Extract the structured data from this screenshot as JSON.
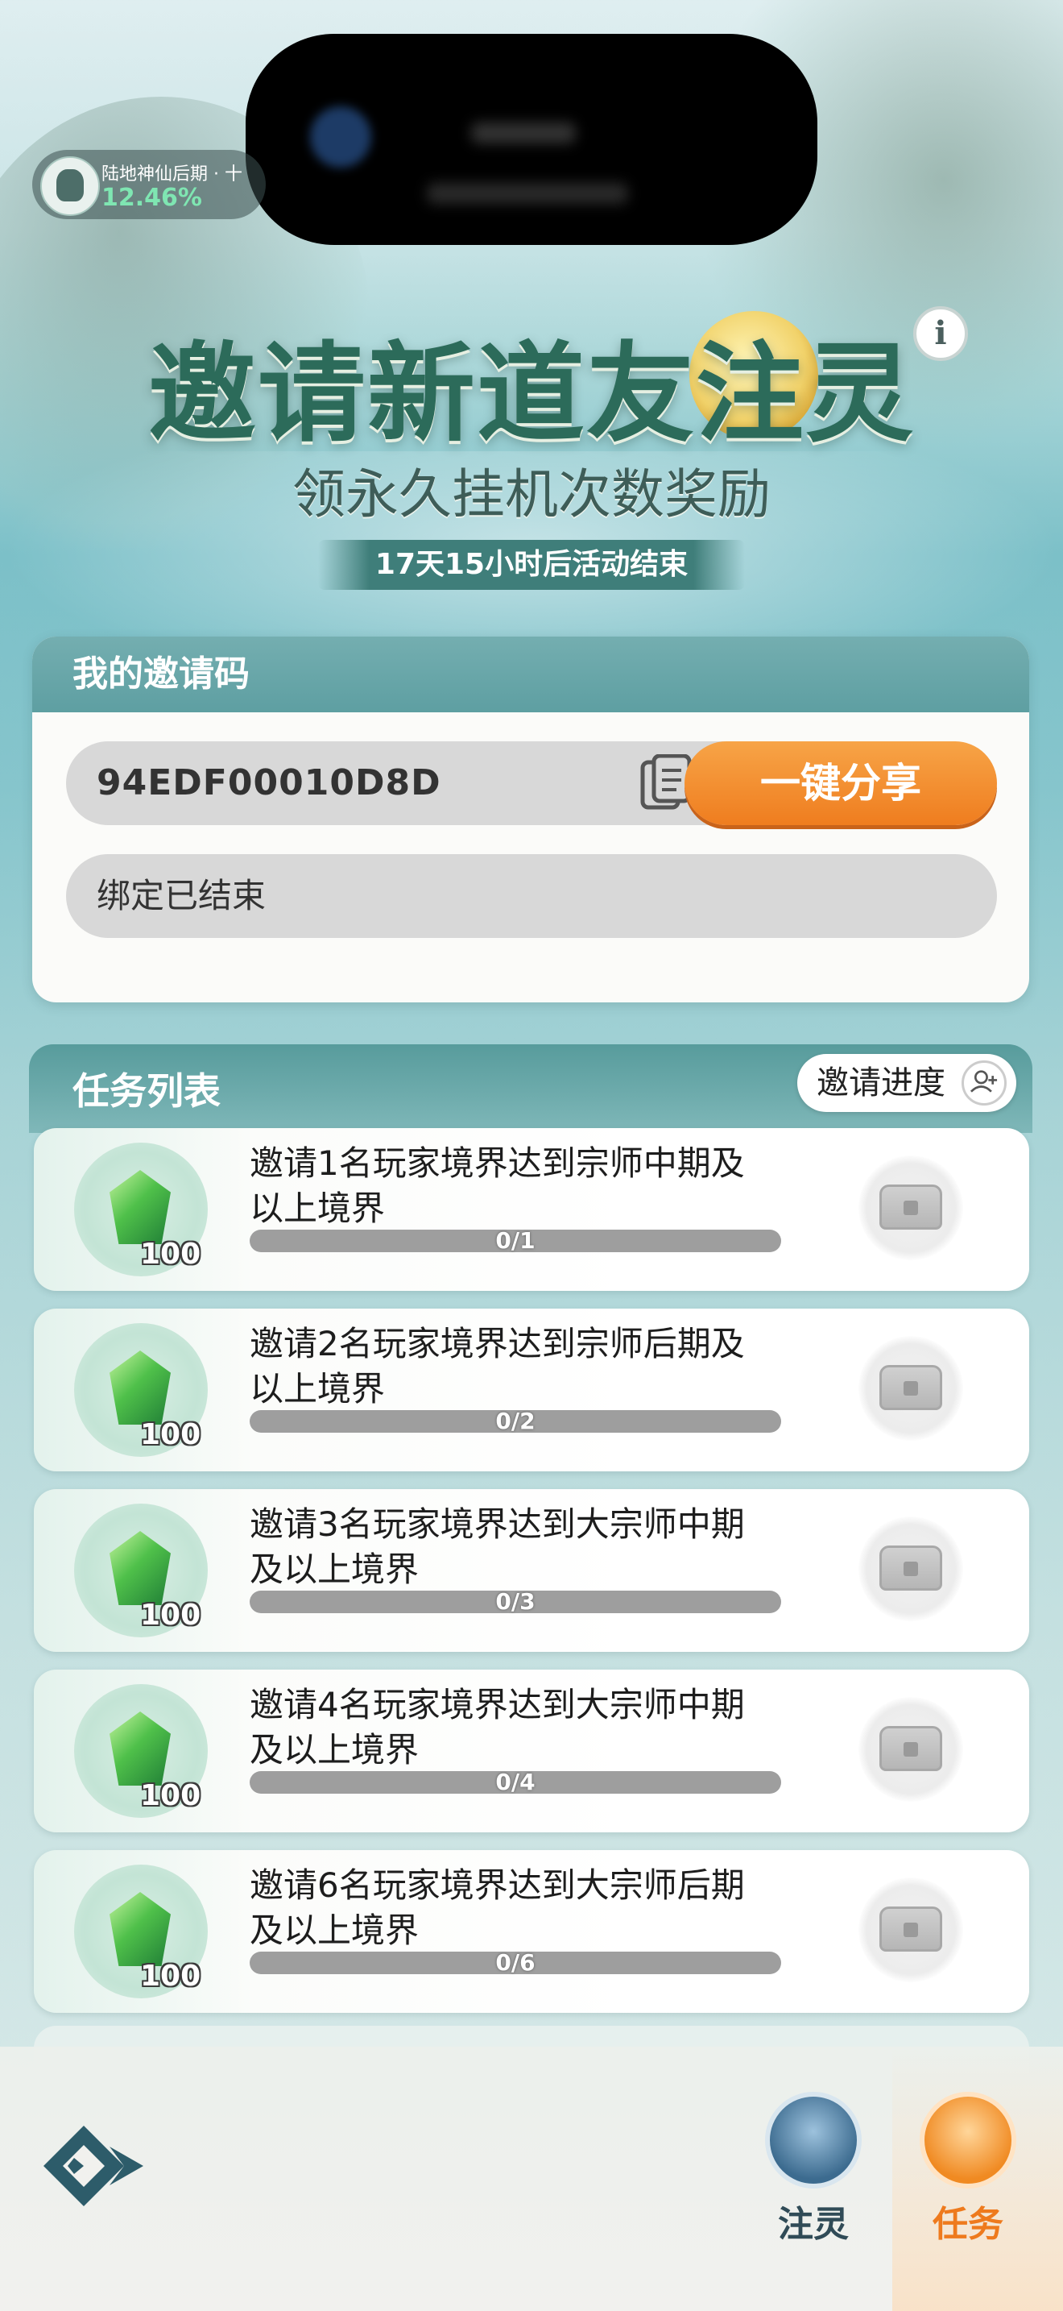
{
  "status": {
    "realm_name": "陆地神仙后期 · 十",
    "realm_percent": "12.46%"
  },
  "header": {
    "title": "邀请新道友注灵",
    "info_label": "i",
    "subtitle": "领永久挂机次数奖励",
    "countdown": "17天15小时后活动结束"
  },
  "invite": {
    "heading": "我的邀请码",
    "code": "94EDF00010D8D",
    "share_label": "一键分享",
    "bind_status": "绑定已结束"
  },
  "tasks": {
    "heading": "任务列表",
    "progress_label": "邀请进度",
    "items": [
      {
        "desc": "邀请1名玩家境界达到宗师中期及以上境界",
        "reward": "100",
        "progress": "0/1",
        "ratio": 0
      },
      {
        "desc": "邀请2名玩家境界达到宗师后期及以上境界",
        "reward": "100",
        "progress": "0/2",
        "ratio": 0
      },
      {
        "desc": "邀请3名玩家境界达到大宗师中期及以上境界",
        "reward": "100",
        "progress": "0/3",
        "ratio": 0
      },
      {
        "desc": "邀请4名玩家境界达到大宗师中期及以上境界",
        "reward": "100",
        "progress": "0/4",
        "ratio": 0
      },
      {
        "desc": "邀请6名玩家境界达到大宗师后期及以上境界",
        "reward": "100",
        "progress": "0/6",
        "ratio": 0
      }
    ]
  },
  "nav": {
    "spirit_label": "注灵",
    "task_label": "任务"
  },
  "icons": {
    "info": "info-icon",
    "copy": "copy-icon",
    "add_user": "add-user-icon",
    "gem": "jade-gem-icon",
    "chest": "treasure-chest-icon",
    "logo": "game-logo-icon"
  },
  "colors": {
    "accent": "#ef7d1f",
    "header": "#2c6b5a",
    "card_head": "#5e9fa2"
  }
}
